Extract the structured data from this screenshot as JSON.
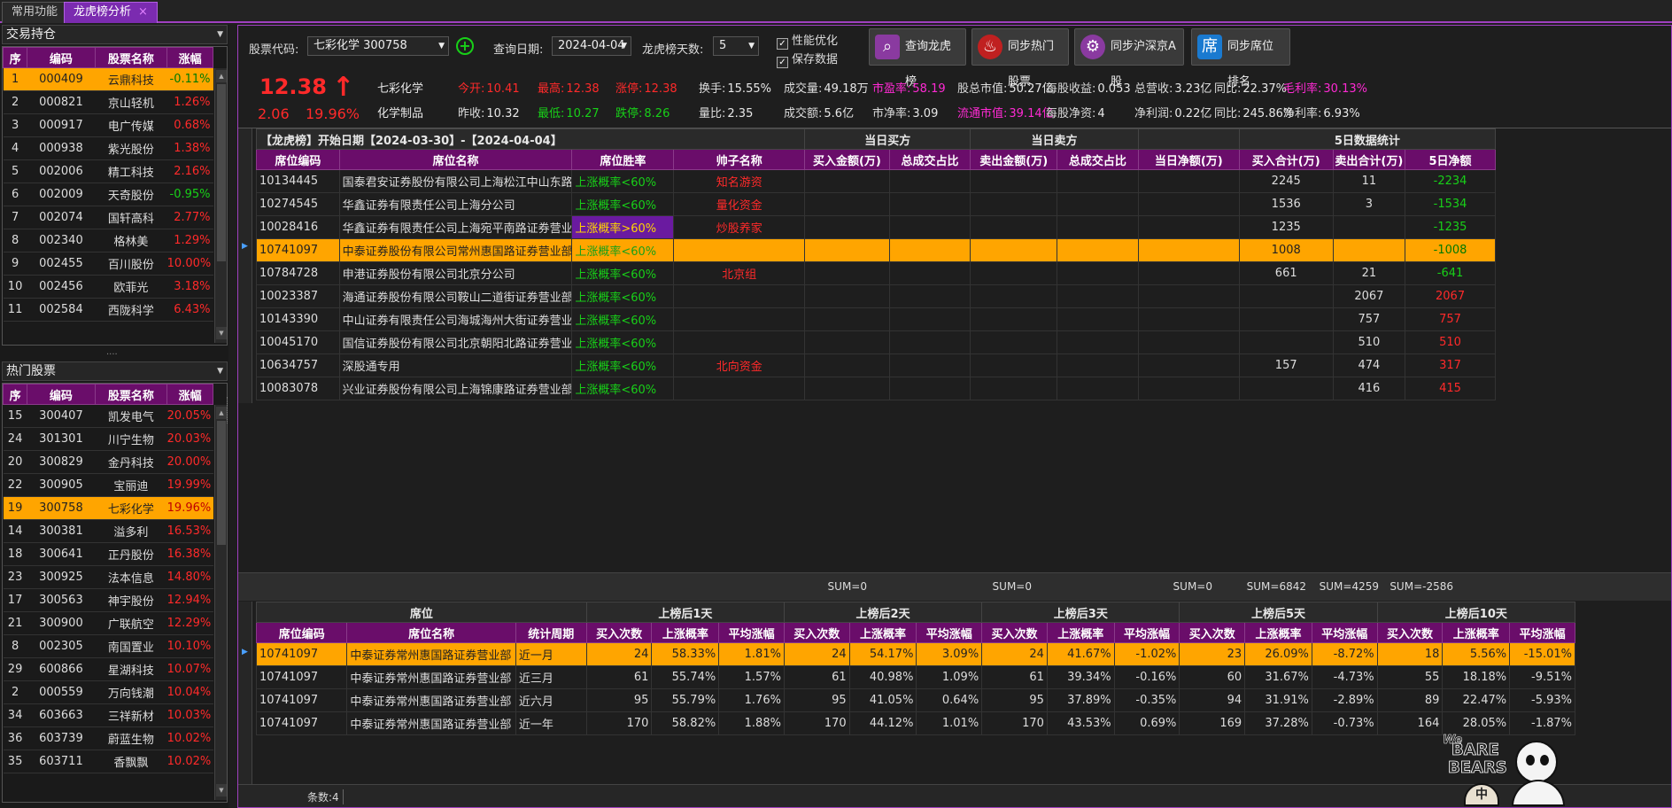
{
  "tabs": [
    {
      "label": "常用功能"
    },
    {
      "label": "龙虎榜分析",
      "close": "×"
    }
  ],
  "holdings": {
    "title": "交易持仓",
    "headers": [
      "序",
      "编码",
      "股票名称",
      "涨幅"
    ],
    "rows": [
      [
        "1",
        "000409",
        "云鼎科技",
        "-0.11%",
        "g"
      ],
      [
        "2",
        "000821",
        "京山轻机",
        "1.26%",
        "r"
      ],
      [
        "3",
        "000917",
        "电广传媒",
        "0.68%",
        "r"
      ],
      [
        "4",
        "000938",
        "紫光股份",
        "1.38%",
        "r"
      ],
      [
        "5",
        "002006",
        "精工科技",
        "2.16%",
        "r"
      ],
      [
        "6",
        "002009",
        "天奇股份",
        "-0.95%",
        "g"
      ],
      [
        "7",
        "002074",
        "国轩高科",
        "2.77%",
        "r"
      ],
      [
        "8",
        "002340",
        "格林美",
        "1.29%",
        "r"
      ],
      [
        "9",
        "002455",
        "百川股份",
        "10.00%",
        "r"
      ],
      [
        "10",
        "002456",
        "欧菲光",
        "3.18%",
        "r"
      ],
      [
        "11",
        "002584",
        "西陇科学",
        "6.43%",
        "r"
      ]
    ]
  },
  "splitter": "....",
  "hot": {
    "title": "热门股票",
    "headers": [
      "序",
      "编码",
      "股票名称",
      "涨幅"
    ],
    "rows": [
      [
        "15",
        "300407",
        "凯发电气",
        "20.05%"
      ],
      [
        "24",
        "301301",
        "川宁生物",
        "20.03%"
      ],
      [
        "20",
        "300829",
        "金丹科技",
        "20.00%"
      ],
      [
        "22",
        "300905",
        "宝丽迪",
        "19.99%"
      ],
      [
        "19",
        "300758",
        "七彩化学",
        "19.96%"
      ],
      [
        "14",
        "300381",
        "溢多利",
        "16.53%"
      ],
      [
        "18",
        "300641",
        "正丹股份",
        "16.38%"
      ],
      [
        "23",
        "300925",
        "法本信息",
        "14.80%"
      ],
      [
        "17",
        "300563",
        "神宇股份",
        "12.94%"
      ],
      [
        "21",
        "300900",
        "广联航空",
        "12.29%"
      ],
      [
        "8",
        "002305",
        "南国置业",
        "10.10%"
      ],
      [
        "29",
        "600866",
        "星湖科技",
        "10.07%"
      ],
      [
        "2",
        "000559",
        "万向钱潮",
        "10.04%"
      ],
      [
        "34",
        "603663",
        "三祥新材",
        "10.03%"
      ],
      [
        "36",
        "603739",
        "蔚蓝生物",
        "10.02%"
      ],
      [
        "35",
        "603711",
        "香飘飘",
        "10.02%"
      ]
    ]
  },
  "toolbar": {
    "code_label": "股票代码:",
    "code_value": "七彩化学 300758",
    "date_label": "查询日期:",
    "date_value": "2024-04-04",
    "days_label": "龙虎榜天数:",
    "days_value": "5",
    "chk1": "性能优化",
    "chk2": "保存数据",
    "btn_query": "查询龙虎榜",
    "btn_hot": "同步热门股票",
    "btn_sync": "同步沪深京A股",
    "btn_seat": "同步席位排名",
    "seat_icon": "席"
  },
  "quote": {
    "price": "12.38",
    "chg": "2.06",
    "pct": "19.96%",
    "name": "七彩化学",
    "industry": "化学制品",
    "r1": [
      [
        "今开:",
        "10.41",
        "r"
      ],
      [
        "最高:",
        "12.38",
        "r"
      ],
      [
        "涨停:",
        "12.38",
        "r"
      ],
      [
        "换手:",
        "15.55%",
        "w"
      ],
      [
        "成交量:",
        "49.18万",
        "w"
      ],
      [
        "市盈率:",
        "58.19",
        "m"
      ],
      [
        "股总市值:",
        "50.27亿",
        "w"
      ],
      [
        "每股收益:",
        "0.053",
        "w"
      ],
      [
        "总营收:",
        "3.23亿",
        "w"
      ],
      [
        "同比:",
        "22.37%",
        "w"
      ],
      [
        "毛利率:",
        "30.13%",
        "m"
      ]
    ],
    "r2": [
      [
        "昨收:",
        "10.32",
        "w"
      ],
      [
        "最低:",
        "10.27",
        "g"
      ],
      [
        "跌停:",
        "8.26",
        "g"
      ],
      [
        "量比:",
        "2.35",
        "w"
      ],
      [
        "成交额:",
        "5.6亿",
        "w"
      ],
      [
        "市净率:",
        "3.09",
        "w"
      ],
      [
        "流通市值:",
        "39.14亿",
        "m"
      ],
      [
        "每股净资:",
        "4",
        "w"
      ],
      [
        "净利润:",
        "0.22亿",
        "w"
      ],
      [
        "同比:",
        "245.86%",
        "w"
      ],
      [
        "净利率:",
        "6.93%",
        "w"
      ]
    ]
  },
  "lhb": {
    "title": "【龙虎榜】开始日期【2024-03-30】-【2024-04-04】",
    "g_buy": "当日买方",
    "g_sell": "当日卖方",
    "g_5d": "5日数据统计",
    "headers": [
      "席位编码",
      "席位名称",
      "席位胜率",
      "帅子名称",
      "买入金额(万)",
      "总成交占比",
      "卖出金额(万)",
      "总成交占比",
      "当日净额(万)",
      "买入合计(万)",
      "卖出合计(万)",
      "5日净额"
    ],
    "rows": [
      [
        "10134445",
        "国泰君安证券股份有限公司上海松江中山东路...",
        "上涨概率<60%",
        "知名游资",
        "2245",
        "11",
        "-2234"
      ],
      [
        "10274545",
        "华鑫证券有限责任公司上海分公司",
        "上涨概率<60%",
        "量化资金",
        "1536",
        "3",
        "-1534"
      ],
      [
        "10028416",
        "华鑫证券有限责任公司上海宛平南路证券营业部",
        "上涨概率>60%",
        "炒股养家",
        "1235",
        "",
        "-1235"
      ],
      [
        "10741097",
        "中泰证券股份有限公司常州惠国路证券营业部",
        "上涨概率<60%",
        "",
        "1008",
        "",
        "-1008"
      ],
      [
        "10784728",
        "申港证券股份有限公司北京分公司",
        "上涨概率<60%",
        "北京组",
        "661",
        "21",
        "-641"
      ],
      [
        "10023387",
        "海通证券股份有限公司鞍山二道街证券营业部",
        "上涨概率<60%",
        "",
        "",
        "2067",
        "2067"
      ],
      [
        "10143390",
        "中山证券有限责任公司海城海州大街证券营业部",
        "上涨概率<60%",
        "",
        "",
        "757",
        "757"
      ],
      [
        "10045170",
        "国信证券股份有限公司北京朝阳北路证券营业部",
        "上涨概率<60%",
        "",
        "",
        "510",
        "510"
      ],
      [
        "10634757",
        "深股通专用",
        "上涨概率<60%",
        "北向资金",
        "157",
        "474",
        "317"
      ],
      [
        "10083078",
        "兴业证券股份有限公司上海锦康路证券营业部",
        "上涨概率<60%",
        "",
        "",
        "416",
        "415"
      ]
    ]
  },
  "sums": [
    "SUM=0",
    "SUM=0",
    "SUM=0",
    "SUM=6842",
    "SUM=4259",
    "SUM=-2586"
  ],
  "stats": {
    "g0": "席位",
    "groups": [
      "上榜后1天",
      "上榜后2天",
      "上榜后3天",
      "上榜后5天",
      "上榜后10天"
    ],
    "headers": [
      "席位编码",
      "席位名称",
      "统计周期",
      "买入次数",
      "上涨概率",
      "平均涨幅"
    ],
    "rows": [
      [
        "10741097",
        "中泰证券常州惠国路证券营业部",
        "近一月",
        "24",
        "58.33%",
        "1.81%",
        "24",
        "54.17%",
        "3.09%",
        "24",
        "41.67%",
        "-1.02%",
        "23",
        "26.09%",
        "-8.72%",
        "18",
        "5.56%",
        "-15.01%"
      ],
      [
        "10741097",
        "中泰证券常州惠国路证券营业部",
        "近三月",
        "61",
        "55.74%",
        "1.57%",
        "61",
        "40.98%",
        "1.09%",
        "61",
        "39.34%",
        "-0.16%",
        "60",
        "31.67%",
        "-4.73%",
        "55",
        "18.18%",
        "-9.51%"
      ],
      [
        "10741097",
        "中泰证券常州惠国路证券营业部",
        "近六月",
        "95",
        "55.79%",
        "1.76%",
        "95",
        "41.05%",
        "0.64%",
        "95",
        "37.89%",
        "-0.35%",
        "94",
        "31.91%",
        "-2.89%",
        "89",
        "22.47%",
        "-5.93%"
      ],
      [
        "10741097",
        "中泰证券常州惠国路证券营业部",
        "近一年",
        "170",
        "58.82%",
        "1.88%",
        "170",
        "44.12%",
        "1.01%",
        "170",
        "43.53%",
        "0.69%",
        "169",
        "37.28%",
        "-0.73%",
        "164",
        "28.05%",
        "-1.87%"
      ]
    ]
  },
  "status": "条数:4",
  "mascot": {
    "line1": "We",
    "line2": "BARE",
    "line3": "BEARS",
    "cn": "中"
  },
  "colors": {
    "accent": "#a040c0",
    "header": "#6a0d6a",
    "selected": "#ffa500",
    "up": "#ff2a2a",
    "down": "#18d018",
    "highlight": "#ff2ad4"
  }
}
